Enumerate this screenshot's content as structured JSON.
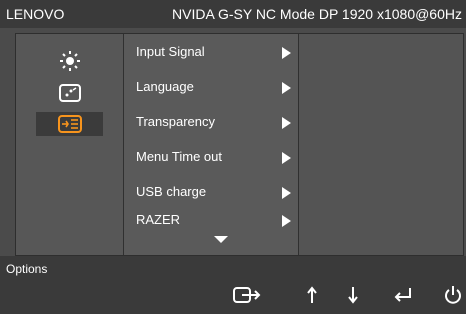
{
  "header": {
    "brand": "LENOVO",
    "mode_info": "NVIDA G-SY NC Mode DP 1920 x1080@60Hz"
  },
  "categories": [
    {
      "icon": "brightness-icon",
      "selected": false
    },
    {
      "icon": "image-settings-icon",
      "selected": false
    },
    {
      "icon": "input-options-icon",
      "selected": true
    }
  ],
  "menu": {
    "items": [
      {
        "label": "Input Signal"
      },
      {
        "label": "Language"
      },
      {
        "label": "Transparency"
      },
      {
        "label": "Menu Time out"
      },
      {
        "label": "USB charge"
      },
      {
        "label": "RAZER"
      }
    ]
  },
  "footer": {
    "title": "Options",
    "buttons": [
      "exit-icon",
      "up-arrow-icon",
      "down-arrow-icon",
      "enter-icon",
      "power-icon"
    ]
  },
  "colors": {
    "background": "#4b4b4b",
    "header_bar": "#3a3a3a",
    "accent_orange": "#f7941d"
  }
}
